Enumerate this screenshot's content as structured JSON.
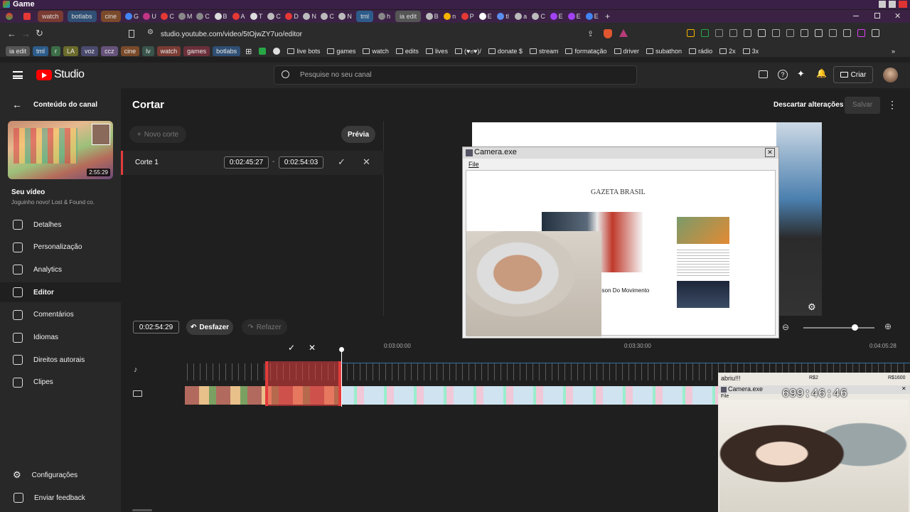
{
  "window": {
    "title": "Game"
  },
  "tabs": {
    "pills": [
      {
        "label": "watch",
        "color": "#7a3b33"
      },
      {
        "label": "botlabs",
        "color": "#2f4f74"
      },
      {
        "label": "cine",
        "color": "#7a4a2a"
      }
    ],
    "mini": [
      {
        "label": "G",
        "color": "#4285f4"
      },
      {
        "label": "U",
        "color": "#c13584"
      },
      {
        "label": "C",
        "color": "#e53935"
      },
      {
        "label": "M",
        "color": "#888888"
      },
      {
        "label": "C",
        "color": "#888888"
      },
      {
        "label": "B",
        "color": "#dddddd"
      },
      {
        "label": "A",
        "color": "#e53935"
      },
      {
        "label": "T",
        "color": "#dddddd"
      },
      {
        "label": "C",
        "color": "#bbbbbb"
      },
      {
        "label": "D",
        "color": "#e53935"
      },
      {
        "label": "N",
        "color": "#bbbbbb"
      },
      {
        "label": "C",
        "color": "#bbbbbb"
      },
      {
        "label": "N",
        "color": "#bbbbbb"
      }
    ],
    "tml": "tml",
    "h_tab": "h",
    "ia_edit": "ia edit",
    "after": [
      {
        "label": "B",
        "color": "#bbbbbb"
      },
      {
        "label": "n",
        "color": "#f4b400"
      },
      {
        "label": "P",
        "color": "#e53935"
      },
      {
        "label": "E",
        "color": "#ffffff"
      },
      {
        "label": "tl",
        "color": "#5b8def"
      },
      {
        "label": "a",
        "color": "#bbbbbb"
      },
      {
        "label": "C",
        "color": "#bbbbbb"
      },
      {
        "label": "E",
        "color": "#a142f4"
      },
      {
        "label": "E",
        "color": "#a142f4"
      },
      {
        "label": "E",
        "color": "#4285f4"
      }
    ],
    "new_tab": "+"
  },
  "omnibar": {
    "url": "studio.youtube.com/video/5tOjwZY7uo/editor"
  },
  "bookmarks": {
    "tags": [
      {
        "label": "ia edit",
        "color": "#555555"
      },
      {
        "label": "tml",
        "color": "#2d5c8a"
      },
      {
        "label": "r",
        "color": "#3c6e47"
      },
      {
        "label": "LA",
        "color": "#6b6b2c"
      },
      {
        "label": "voz",
        "color": "#4a4a6e"
      },
      {
        "label": "ccz",
        "color": "#66527a"
      },
      {
        "label": "cine",
        "color": "#7a4a2a"
      },
      {
        "label": "lv",
        "color": "#39544b"
      },
      {
        "label": "watch",
        "color": "#7a3b33"
      },
      {
        "label": "games",
        "color": "#6b2f3a"
      },
      {
        "label": "botlabs",
        "color": "#2f4f74"
      }
    ],
    "items": [
      "live bots",
      "games",
      "watch",
      "edits",
      "lives",
      "(♥ಠ♥)/",
      "donate $",
      "stream",
      "formatação",
      "driver",
      "subathon",
      "rádio",
      "2x",
      "3x"
    ]
  },
  "header": {
    "logo": "Studio",
    "search_placeholder": "Pesquise no seu canal",
    "create": "Criar"
  },
  "sidebar": {
    "back": "Conteúdo do canal",
    "duration": "2:55:29",
    "your_video": "Seu vídeo",
    "video_title": "Joguinho novo! Lost & Found co.",
    "items": [
      {
        "label": "Detalhes",
        "icon": "pencil-icon"
      },
      {
        "label": "Personalização",
        "icon": "broadcast-icon"
      },
      {
        "label": "Analytics",
        "icon": "analytics-icon"
      },
      {
        "label": "Editor",
        "icon": "editor-icon"
      },
      {
        "label": "Comentários",
        "icon": "comments-icon"
      },
      {
        "label": "Idiomas",
        "icon": "subtitles-icon"
      },
      {
        "label": "Direitos autorais",
        "icon": "copyright-icon"
      },
      {
        "label": "Clipes",
        "icon": "scissors-icon"
      }
    ],
    "settings": "Configurações",
    "feedback": "Enviar feedback"
  },
  "editor": {
    "title": "Cortar",
    "discard": "Descartar alterações",
    "save": "Salvar",
    "new_cut": "Novo corte",
    "preview": "Prévia",
    "cut_label": "Corte 1",
    "cut_start": "0:02:45:27",
    "cut_sep": "-",
    "cut_end": "0:02:54:03",
    "playhead_time": "0:02:54:29",
    "undo": "Desfazer",
    "redo": "Refazer",
    "ruler": [
      "0:03:00:00",
      "0:03:30:00",
      "0:04:05:28"
    ]
  },
  "overlay_camera": {
    "title": "Camera.exe",
    "menu": "File",
    "site": "GAZETA BRASIL",
    "headline": "Carlson Do Movimento"
  },
  "overlay_webcam2": {
    "top_text": "abriu!!!",
    "r52": "R$2",
    "r1600": "R$1600",
    "title": "Camera.exe",
    "menu": "File",
    "clock": "699:46:46"
  }
}
